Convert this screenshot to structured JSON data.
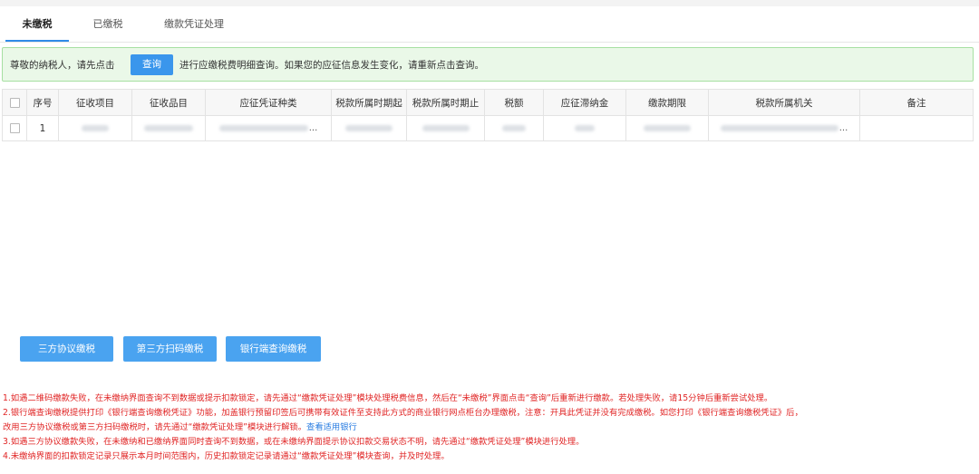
{
  "tabs": [
    {
      "label": "未缴税",
      "active": true
    },
    {
      "label": "已缴税",
      "active": false
    },
    {
      "label": "缴款凭证处理",
      "active": false
    }
  ],
  "notice": {
    "text_before": "尊敬的纳税人，请先点击",
    "query_button": "查询",
    "text_after": "进行应缴税费明细查询。如果您的应征信息发生变化，请重新点击查询。"
  },
  "table": {
    "headers": [
      "",
      "序号",
      "征收项目",
      "征收品目",
      "应征凭证种类",
      "税款所属时期起",
      "税款所属时期止",
      "税额",
      "应征滞纳金",
      "缴款期限",
      "税款所属机关",
      "备注"
    ],
    "rows": [
      {
        "index": "1",
        "ellipsis_col4": "...",
        "ellipsis_col10": "...",
        "remark": ""
      }
    ]
  },
  "actions": {
    "tripartite": "三方协议缴税",
    "scan": "第三方扫码缴税",
    "bank": "银行端查询缴税"
  },
  "notes": {
    "line1": "1.如遇二维码缴款失败，在未缴纳界面查询不到数据或提示扣款锁定，请先通过“缴款凭证处理”模块处理税费信息，然后在“未缴税”界面点击“查询”后重新进行缴款。若处理失败，请15分钟后重新尝试处理。",
    "line2": "2.银行端查询缴税提供打印《银行端查询缴税凭证》功能，加盖银行预留印签后可携带有效证件至支持此方式的商业银行网点柜台办理缴税，注意：开具此凭证并没有完成缴税。如您打印《银行端查询缴税凭证》后，",
    "line3": "改用三方协议缴税或第三方扫码缴税时，请先通过“缴款凭证处理”模块进行解锁。",
    "line3_link": "查看适用银行",
    "line4": "3.如遇三方协议缴款失败，在未缴纳和已缴纳界面同时查询不到数据，或在未缴纳界面提示协议扣款交易状态不明，请先通过“缴款凭证处理”模块进行处理。",
    "line5": "4.未缴纳界面的扣款锁定记录只展示本月时间范围内，历史扣款锁定记录请通过“缴款凭证处理”模块查询，并及时处理。"
  },
  "colors": {
    "primary": "#3a96ec",
    "notice_bg": "#eaf8e8",
    "warning_text": "#e02424"
  }
}
